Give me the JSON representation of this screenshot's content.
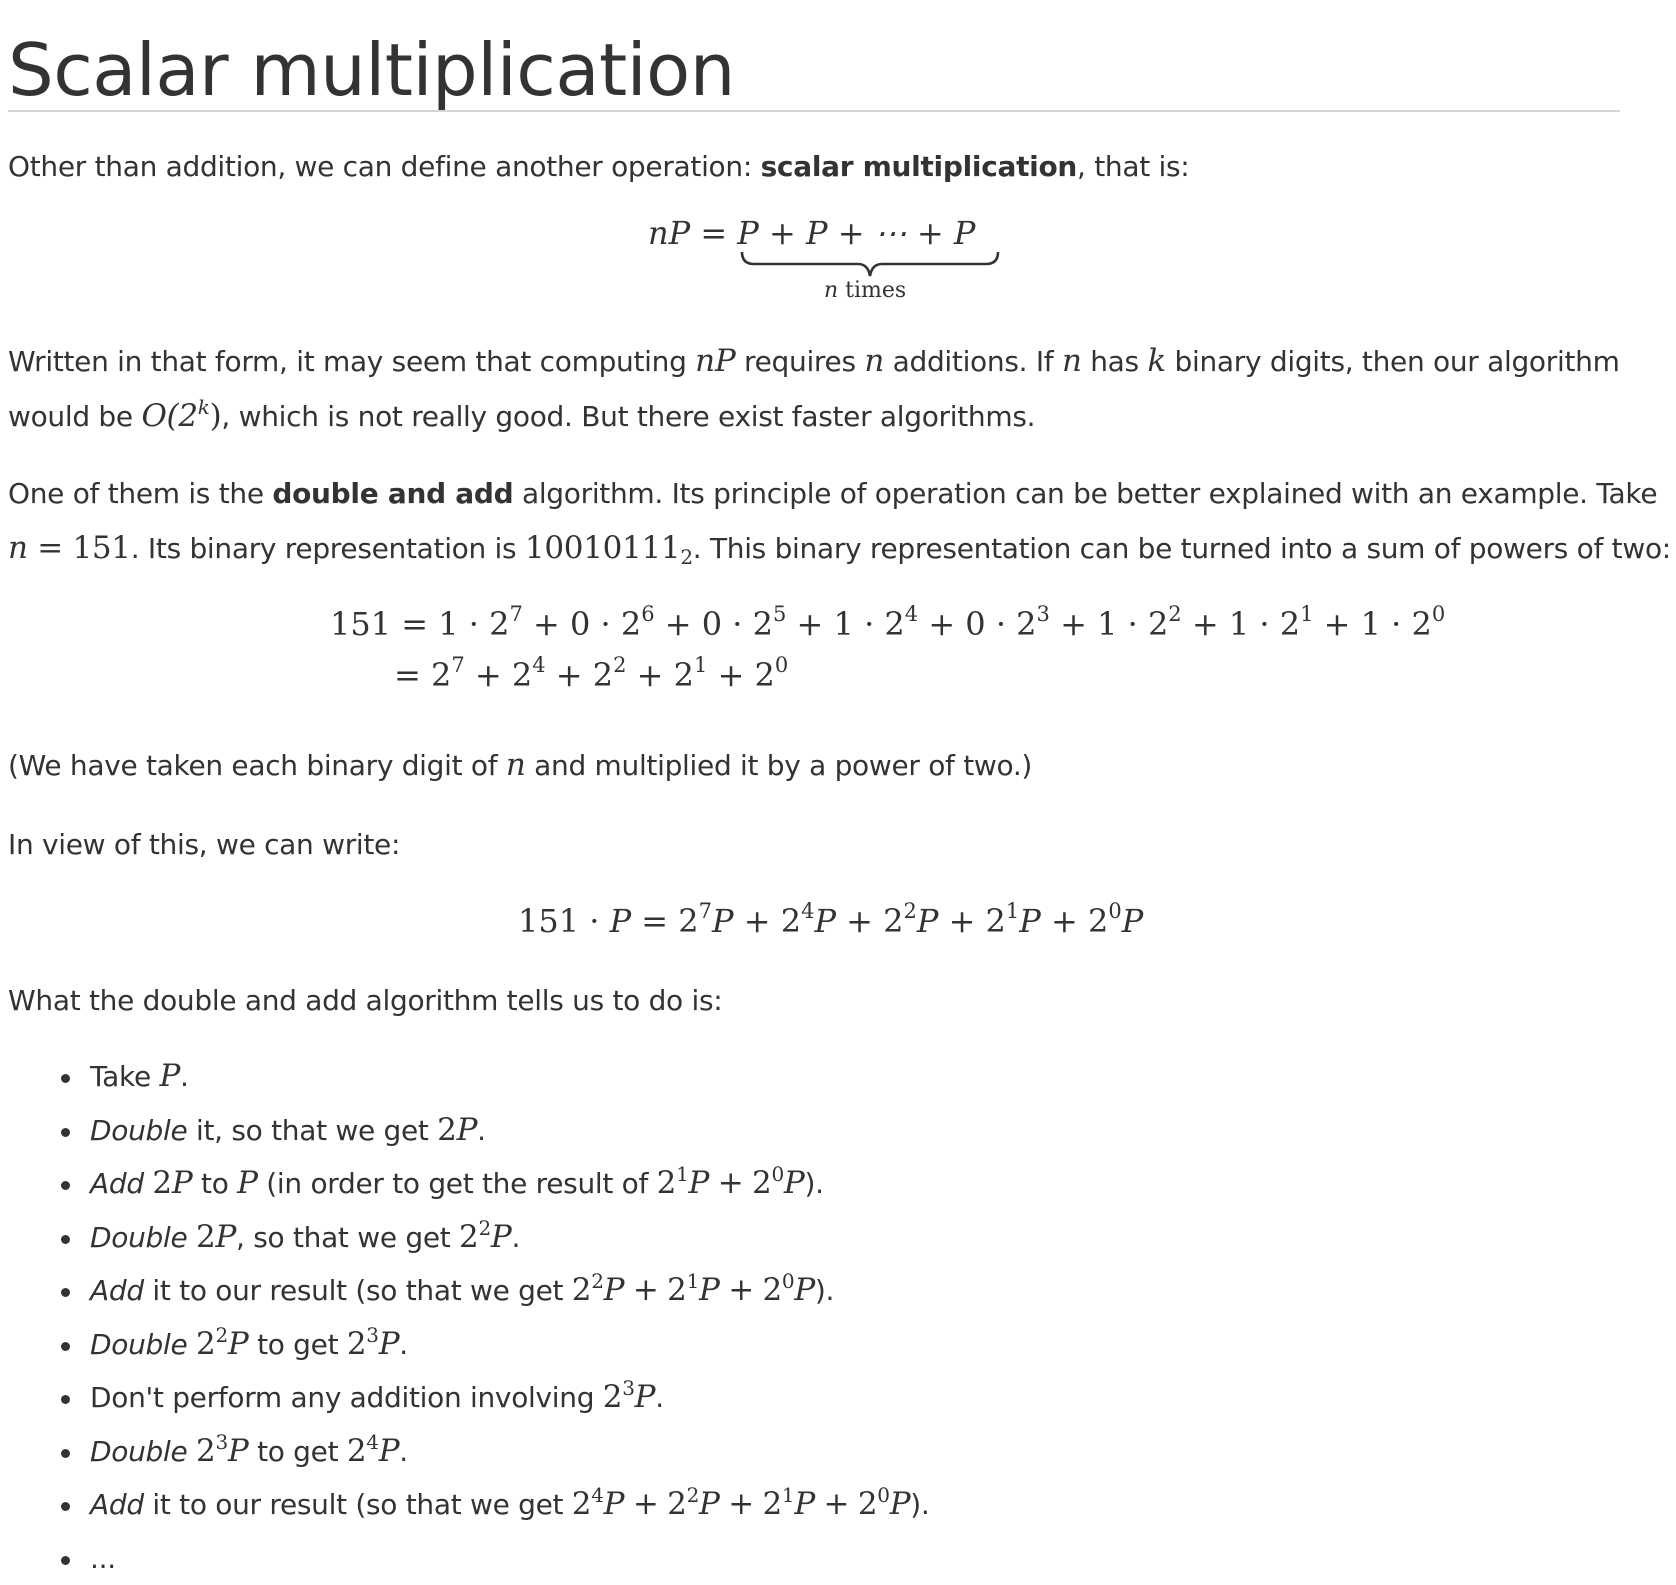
{
  "title": "Scalar multiplication",
  "intro": {
    "before": "Other than addition, we can define another operation: ",
    "bold": "scalar multiplication",
    "after": ", that is:"
  },
  "eq1": {
    "lhs": "nP",
    "eq": "=",
    "rhs": "P + P + ⋯ + P",
    "underbrace_label": "n times"
  },
  "para2": {
    "line1_a": "Written in that form, it may seem that computing ",
    "nP": "nP",
    "line1_b": " requires ",
    "n1": "n",
    "line1_c": " additions. If ",
    "n2": "n",
    "line1_d": " has ",
    "k": "k",
    "line1_e": " binary digits, then our algorithm",
    "line2_a": "would be ",
    "big_o": "O(2",
    "big_o_exp": "k",
    "big_o_close": ")",
    "line2_b": ", which is not really good. But there exist faster algorithms."
  },
  "para3": {
    "line1_a": "One of them is the ",
    "bold": "double and add",
    "line1_b": " algorithm. Its principle of operation can be better explained with an example. Take",
    "n_eq": "n = 151",
    "line2_a": ". Its binary representation is ",
    "binary": "10010111",
    "binary_base": "2",
    "line2_b": ". This binary representation can be turned into a sum of powers of two:"
  },
  "eq2": {
    "row1": "151 = 1 · 2^7 + 0 · 2^6 + 0 · 2^5 + 1 · 2^4 + 0 · 2^3 + 1 · 2^2 + 1 · 2^1 + 1 · 2^0",
    "row2": "= 2^7 + 2^4 + 2^2 + 2^1 + 2^0"
  },
  "para4": {
    "a": "(We have taken each binary digit of ",
    "n": "n",
    "b": " and multiplied it by a power of two.)"
  },
  "para5": "In view of this, we can write:",
  "eq3": "151 · P = 2^7 P + 2^4 P + 2^2 P + 2^1 P + 2^0 P",
  "para6": "What the double and add algorithm tells us to do is:",
  "steps": [
    "Take P.",
    "Double it, so that we get 2P.",
    "Add 2P to P (in order to get the result of 2^1 P + 2^0 P).",
    "Double 2P, so that we get 2^2 P.",
    "Add it to our result (so that we get 2^2 P + 2^1 P + 2^0 P).",
    "Double 2^2 P to get 2^3 P.",
    "Don't perform any addition involving 2^3 P.",
    "Double 2^3 P to get 2^4 P.",
    "Add it to our result (so that we get 2^4 P + 2^2 P + 2^1 P + 2^0 P).",
    "..."
  ]
}
